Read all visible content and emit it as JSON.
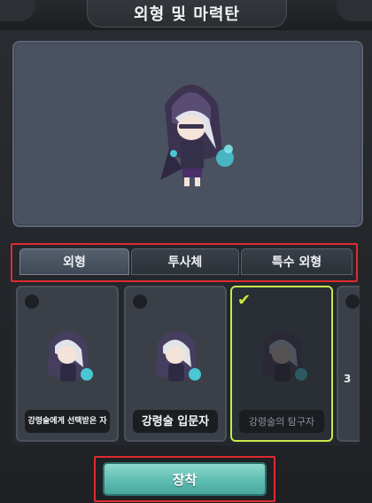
{
  "title": "외형 및 마력탄",
  "tabs": [
    {
      "label": "외형",
      "active": true
    },
    {
      "label": "투사체",
      "active": false
    },
    {
      "label": "특수 외형",
      "active": false
    }
  ],
  "skins": [
    {
      "label": "강령술에게 선택받은 자",
      "selected": false
    },
    {
      "label": "강령술 입문자",
      "selected": false
    },
    {
      "label": "강령술의 탐구자",
      "selected": true
    }
  ],
  "partial_card_number": "3",
  "equip_label": "장착",
  "colors": {
    "accent_teal": "#5dbdb2",
    "selected_border": "#c7e84a",
    "highlight_red": "#e02a2f",
    "preview_bg": "#4a5161"
  }
}
